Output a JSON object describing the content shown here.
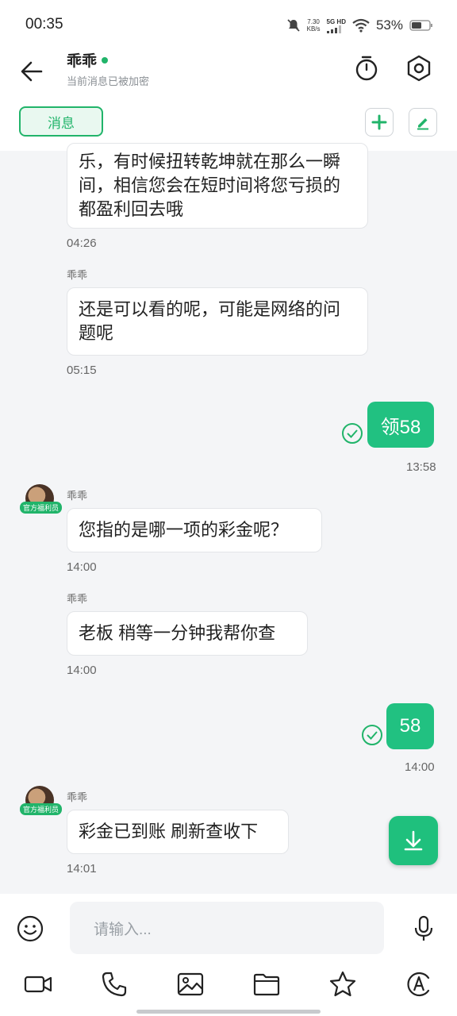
{
  "status_bar": {
    "time": "00:35",
    "speed_value": "7.30",
    "speed_unit": "KB/s",
    "network": "5G HD",
    "battery": "53%"
  },
  "header": {
    "title": "乖乖",
    "subtitle": "当前消息已被加密",
    "tab_label": "消息"
  },
  "messages": {
    "m1": {
      "text": "乐，有时候扭转乾坤就在那么一瞬间，相信您会在短时间将您亏损的都盈利回去哦",
      "time": "04:26"
    },
    "m2": {
      "sender": "乖乖",
      "text": "还是可以看的呢，可能是网络的问题呢",
      "time": "05:15"
    },
    "m3": {
      "text": "领58",
      "time": "13:58"
    },
    "m4": {
      "sender": "乖乖",
      "badge": "官方福利员",
      "text": "您指的是哪一项的彩金呢？",
      "time": "14:00"
    },
    "m5": {
      "sender": "乖乖",
      "text": "老板 稍等一分钟我帮你查",
      "time": "14:00"
    },
    "m6": {
      "text": "58",
      "time": "14:00"
    },
    "m7": {
      "sender": "乖乖",
      "badge": "官方福利员",
      "text": "彩金已到账 刷新查收下",
      "time": "14:01"
    }
  },
  "composer": {
    "placeholder": "请输入..."
  },
  "icons": [
    "back-arrow-icon",
    "timer-icon",
    "settings-hex-icon",
    "plus-icon",
    "edit-icon",
    "check-circle-icon",
    "download-icon",
    "emoji-icon",
    "mic-icon",
    "video-icon",
    "phone-icon",
    "image-icon",
    "folder-icon",
    "star-icon",
    "font-icon"
  ],
  "colors": {
    "accent": "#21b46a",
    "bubble_mine": "#21c181",
    "background": "#f4f5f7"
  }
}
